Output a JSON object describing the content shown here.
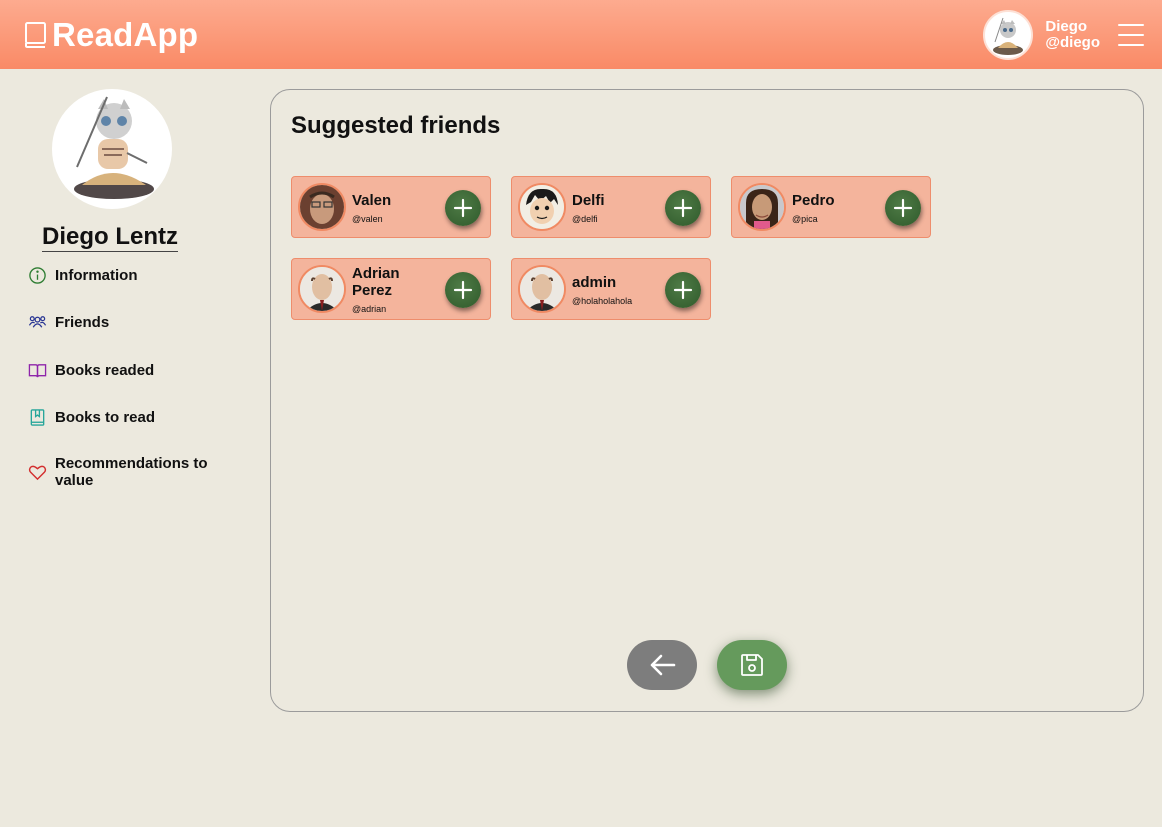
{
  "header": {
    "app_name": "ReadApp",
    "user_name": "Diego",
    "user_handle": "@diego"
  },
  "sidebar": {
    "profile_name": "Diego Lentz",
    "items": [
      {
        "label": "Information",
        "icon": "info-icon",
        "color": "#2e7d32"
      },
      {
        "label": "Friends",
        "icon": "users-icon",
        "color": "#283593"
      },
      {
        "label": "Books readed",
        "icon": "open-book-icon",
        "color": "#8e24aa"
      },
      {
        "label": "Books to read",
        "icon": "bookmark-book-icon",
        "color": "#26a69a"
      },
      {
        "label": "Recommendations to value",
        "icon": "heart-icon",
        "color": "#d32f2f"
      }
    ]
  },
  "main": {
    "title": "Suggested friends",
    "friends": [
      {
        "name": "Valen",
        "username": "@valen"
      },
      {
        "name": "Delfi",
        "username": "@delfi"
      },
      {
        "name": "Pedro",
        "username": "@pica"
      },
      {
        "name": "Adrian Perez",
        "username": "@adrian"
      },
      {
        "name": "admin",
        "username": "@holaholahola"
      }
    ]
  },
  "colors": {
    "header_gradient_top": "#fdab8f",
    "header_gradient_bottom": "#f98a66",
    "background": "#ece9de",
    "card_fill": "#f4b49c",
    "add_button": "#3d6a37",
    "save_button": "#659a5c",
    "back_button": "#7d7d7d"
  }
}
